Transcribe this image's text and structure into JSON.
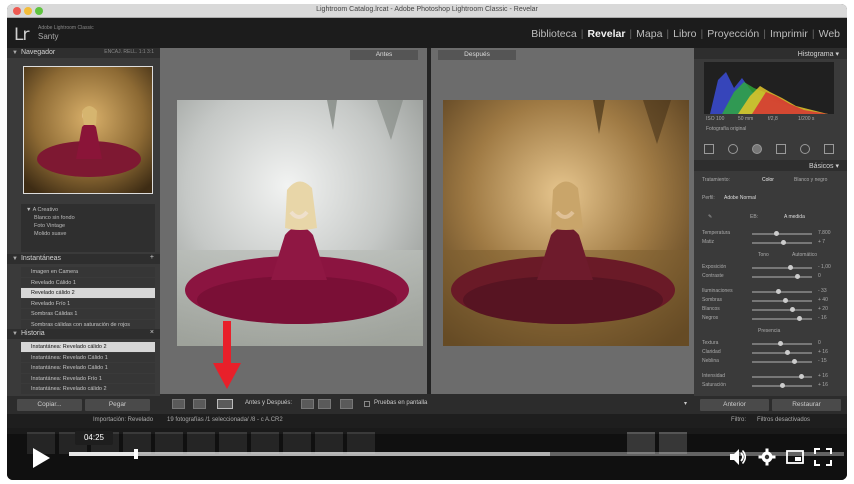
{
  "window": {
    "title": "Lightroom Catalog.lrcat - Adobe Photoshop Lightroom Classic - Revelar"
  },
  "header": {
    "logo": "Lr",
    "product": "Adobe Lightroom Classic",
    "user": "Santy",
    "modules": [
      "Biblioteca",
      "Revelar",
      "Mapa",
      "Libro",
      "Proyección",
      "Imprimir",
      "Web"
    ],
    "active_module": "Revelar"
  },
  "left_panel": {
    "navigator": {
      "title": "Navegador",
      "options": "ENCAJ.   RELL.   1:1   3:1"
    },
    "presets_box": {
      "items": [
        "▼ A Creativo",
        "Blanco sin fondo",
        "Foto Vintage",
        "Molido suave"
      ]
    },
    "snapshots": {
      "title": "Instantáneas",
      "items": [
        "Imagen en Camera",
        "Revelado Cálido 1",
        "Revelado cálido 2",
        "Revelado Frío 1",
        "Sombras Cálidas 1",
        "Sombras cálidas con saturación de rojos"
      ],
      "selected_index": 2
    },
    "history": {
      "title": "Historia",
      "items": [
        "Instantánea: Revelado cálido 2",
        "Instantánea: Revelado Cálido 1",
        "Instantánea: Revelado Cálido 1",
        "Instantánea: Revelado Frío 1",
        "Instantánea: Revelado cálido 2"
      ],
      "selected_index": 0
    },
    "buttons": {
      "copy": "Copiar...",
      "paste": "Pegar"
    }
  },
  "center": {
    "before_label": "Antes",
    "after_label": "Después",
    "toolbar": {
      "mode_label": "Antes y Después:",
      "soft_proof_label": "Pruebas en pantalla"
    }
  },
  "right_panel": {
    "histogram_title": "Histograma",
    "histogram_info": [
      "ISO 100",
      "50 mm",
      "f/2,8",
      "1/200 s"
    ],
    "original_photo_label": "Fotografía original",
    "basic_title": "Básicos",
    "treatment": {
      "label": "Tratamiento:",
      "color": "Color",
      "bw": "Blanco y negro"
    },
    "profile": {
      "label": "Perfil:",
      "value": "Adobe Normal"
    },
    "wb": {
      "label": "EB:",
      "value": "A medida"
    },
    "sliders": [
      {
        "label": "Temperatura",
        "value": "7.800"
      },
      {
        "label": "Matiz",
        "value": "+ 7"
      },
      {
        "label": "Exposición",
        "value": "- 1,00"
      },
      {
        "label": "Contraste",
        "value": "0"
      },
      {
        "label": "Iluminaciones",
        "value": "- 33"
      },
      {
        "label": "Sombras",
        "value": "+ 40"
      },
      {
        "label": "Blancos",
        "value": "+ 20"
      },
      {
        "label": "Negros",
        "value": "- 16"
      },
      {
        "label": "Textura",
        "value": "0"
      },
      {
        "label": "Claridad",
        "value": "+ 16"
      },
      {
        "label": "Neblina",
        "value": "- 15"
      },
      {
        "label": "Intensidad",
        "value": "+ 16"
      },
      {
        "label": "Saturación",
        "value": "+ 16"
      }
    ],
    "tone_label": "Tono",
    "tone_auto": "Automático",
    "presence_label": "Presencia",
    "buttons": {
      "prev": "Anterior",
      "reset": "Restaurar"
    }
  },
  "filmstrip": {
    "source": "Importación: Revelado",
    "count_text": "19 fotografías /1 seleccionada/ /8 - c A.CR2",
    "filter_label": "Filtro:",
    "filter_value": "Filtros desactivados"
  },
  "player": {
    "time": "04:25",
    "progress": 0.087,
    "buffered": 0.62
  },
  "colors": {
    "arrow": "#e8202a",
    "dress": "#8a1438"
  }
}
